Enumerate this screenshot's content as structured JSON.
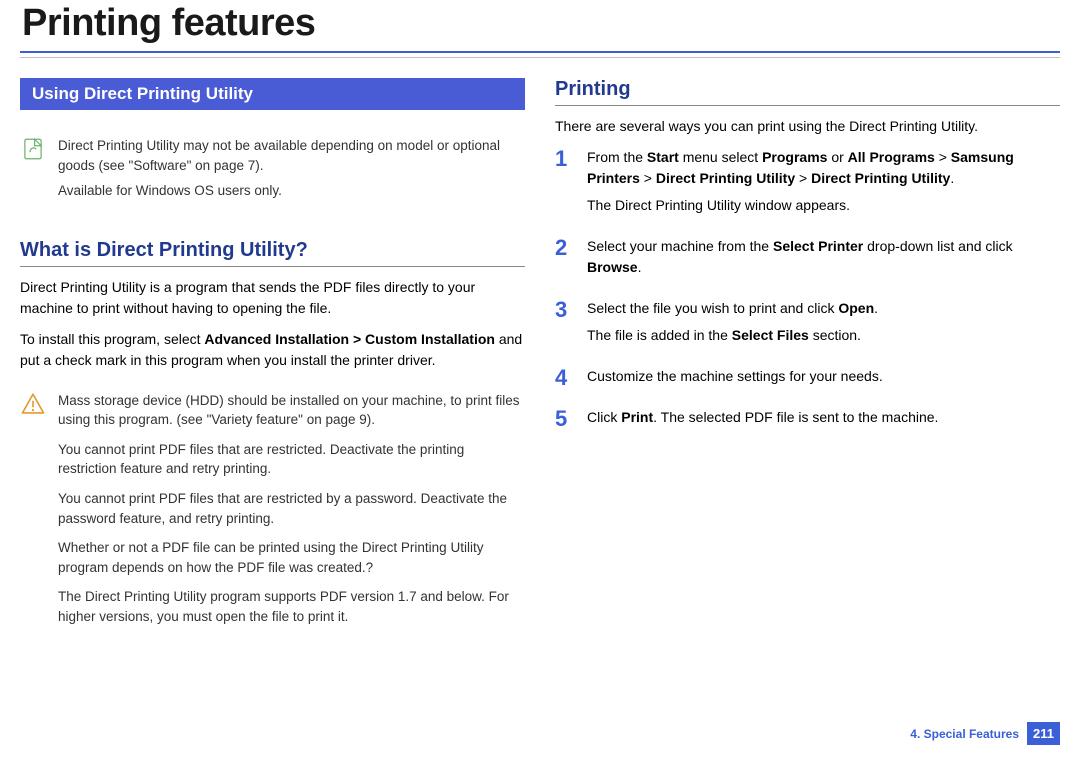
{
  "title": "Printing features",
  "left": {
    "section_bar": "Using Direct Printing Utility",
    "info_note": {
      "line1_pre": "Direct Printing Utility may not be available depending on model or optional goods (see ",
      "line1_link": "\"Software\" on page 7",
      "line1_post": ").",
      "line2": "Available for Windows OS users only."
    },
    "subhead1": "What is Direct Printing Utility?",
    "para1": "Direct Printing Utility is a program that sends the PDF files directly to your machine to print without having to opening the file.",
    "para2_pre": "To install this program, select ",
    "para2_bold": "Advanced Installation > Custom Installation",
    "para2_post": " and put a check mark in this program when you install the printer driver.",
    "warn": {
      "w1_pre": "Mass storage device (HDD) should be installed on your machine, to print files using this program. (see ",
      "w1_link": "\"Variety feature\" on page 9",
      "w1_post": ").",
      "w2": "You cannot print PDF files that are restricted. Deactivate the printing restriction feature and retry printing.",
      "w3": "You cannot print PDF files that are restricted by a password. Deactivate the password feature, and retry printing.",
      "w4": "Whether or not a PDF file can be printed using the Direct Printing Utility program depends on how the PDF file was created.?",
      "w5": "The Direct Printing Utility program supports PDF version 1.7 and below. For higher versions, you must open the file to print it."
    }
  },
  "right": {
    "subhead": "Printing",
    "intro": "There are several ways you can print using the Direct Printing Utility.",
    "steps": {
      "s1": {
        "num": "1",
        "l1_pre": "From the ",
        "l1_b1": "Start",
        "l1_mid1": " menu select ",
        "l1_b2": "Programs",
        "l1_mid2": " or ",
        "l1_b3": "All Programs",
        "l1_mid3": " > ",
        "l1_b4": "Samsung Printers",
        "l1_mid4": " > ",
        "l1_b5": "Direct Printing Utility",
        "l1_mid5": " > ",
        "l1_b6": "Direct Printing Utility",
        "l1_post": ".",
        "l2": "The Direct Printing Utility window appears."
      },
      "s2": {
        "num": "2",
        "l1_pre": "Select your machine from the ",
        "l1_b1": "Select Printer",
        "l1_mid": " drop-down list and click ",
        "l1_b2": "Browse",
        "l1_post": "."
      },
      "s3": {
        "num": "3",
        "l1_pre": "Select the file you wish to print and click ",
        "l1_b1": "Open",
        "l1_post": ".",
        "l2_pre": "The file is added in the ",
        "l2_b1": "Select Files",
        "l2_post": " section."
      },
      "s4": {
        "num": "4",
        "l1": "Customize the machine settings for your needs."
      },
      "s5": {
        "num": "5",
        "l1_pre": "Click ",
        "l1_b1": "Print",
        "l1_post": ". The selected PDF file is sent to the machine."
      }
    }
  },
  "footer": {
    "chapter": "4.  Special Features",
    "page": "211"
  }
}
